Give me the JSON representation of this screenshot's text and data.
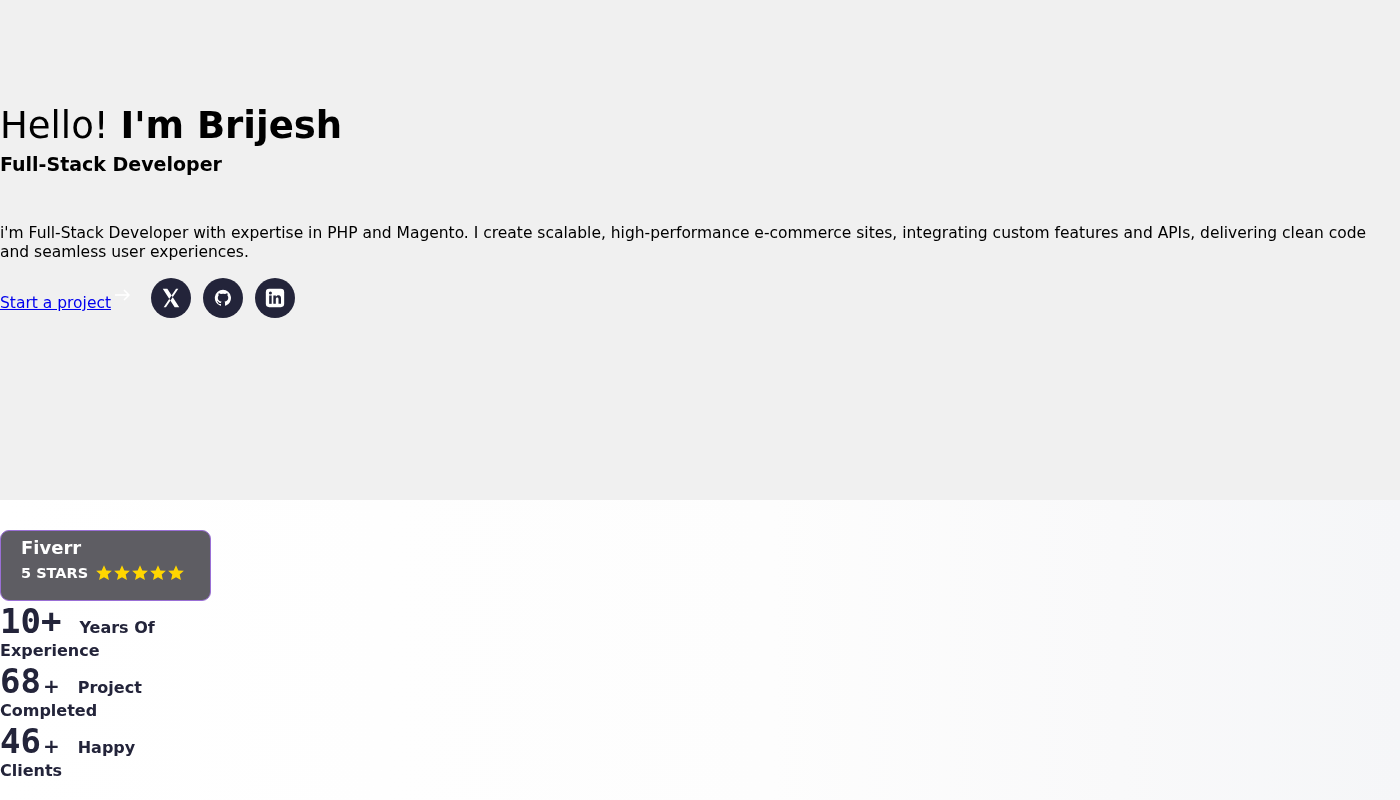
{
  "hero": {
    "heading": "Hello! **I'm Brijesh**",
    "subtitle": "Full-Stack Developer",
    "intro": "i'm Full-Stack Developer with expertise in PHP and Magento. I create scalable, high-performance e-commerce sites, integrating custom features and APIs, delivering clean code and seamless user experiences.",
    "cta": "Start a project",
    "socials": [
      {
        "kind": "x"
      },
      {
        "kind": "github"
      },
      {
        "kind": "linkedin"
      }
    ]
  },
  "rating": {
    "platform": "Fiverr",
    "label": "5 STARS",
    "stars": 5
  },
  "stats": [
    {
      "number": "10+",
      "label": "Years Of Experience"
    },
    {
      "number": "68",
      "suffix": "+",
      "label": "Project Completed"
    },
    {
      "number": "46",
      "suffix": "+",
      "label": "Happy Clients"
    }
  ]
}
